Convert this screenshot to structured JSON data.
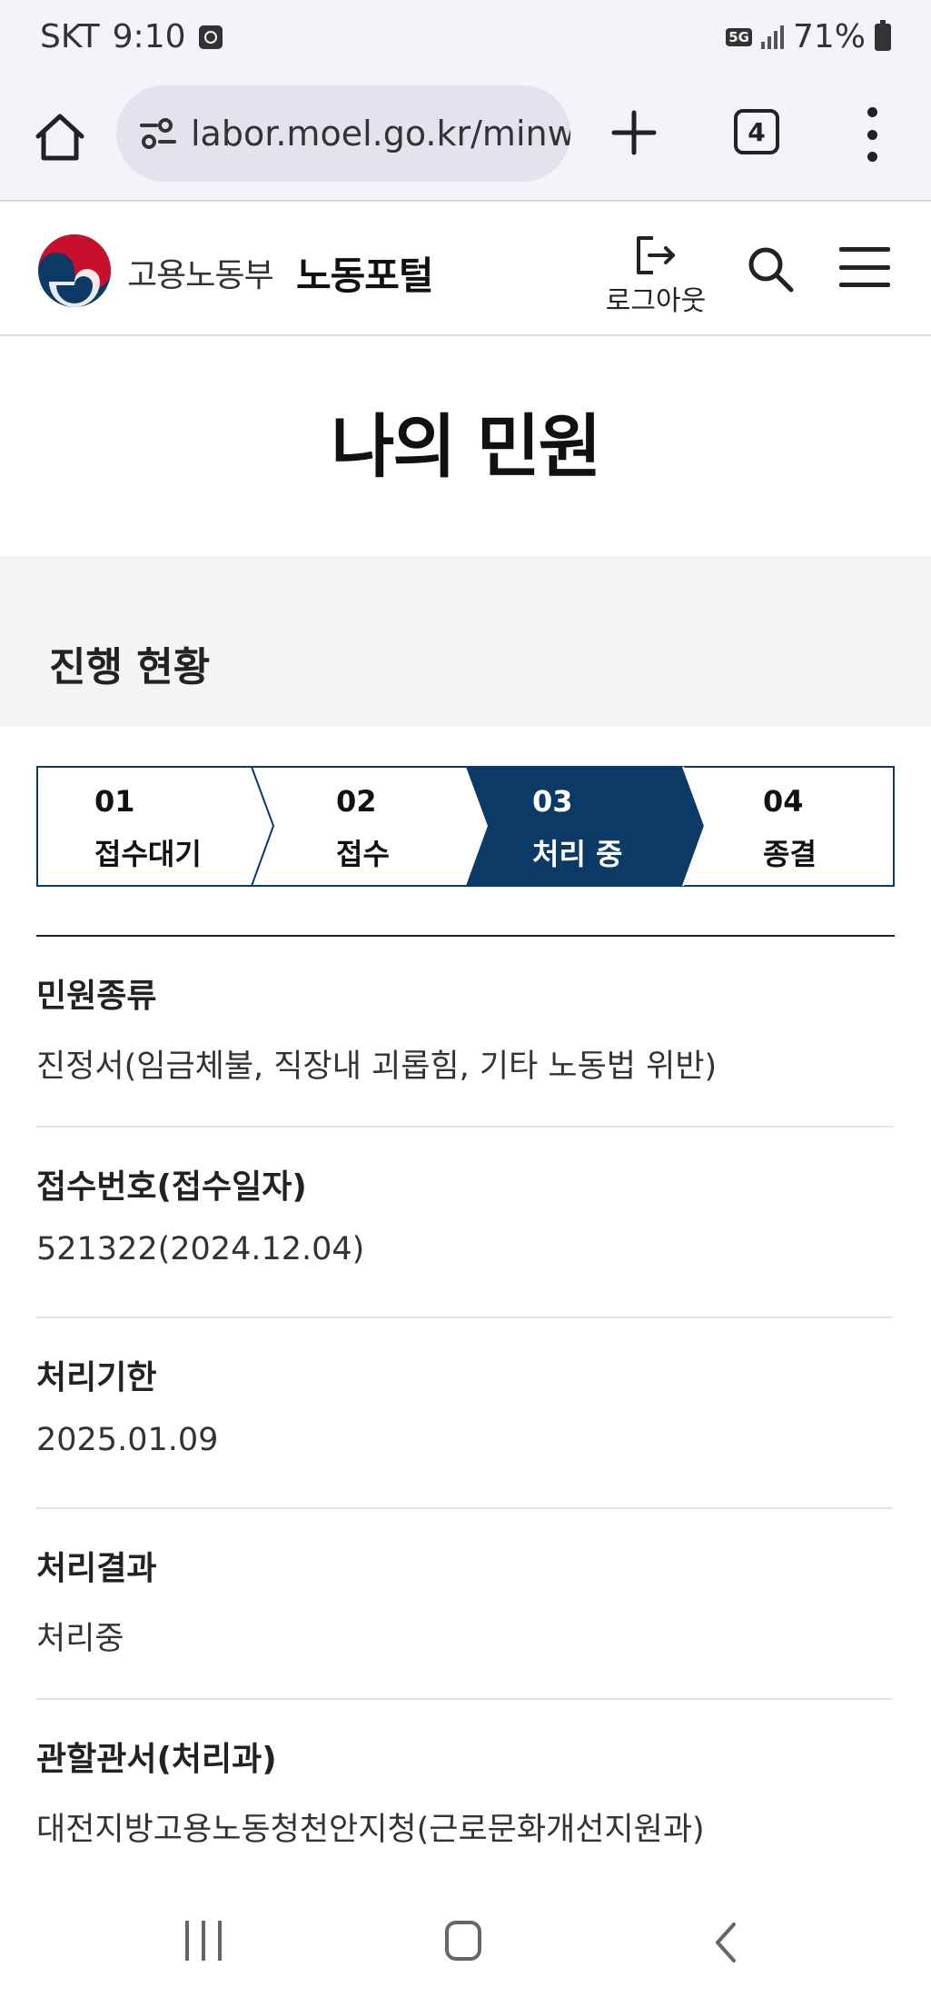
{
  "status_bar": {
    "carrier": "SKT",
    "time": "9:10",
    "network": "5G",
    "battery": "71%"
  },
  "browser": {
    "url": "labor.moel.go.kr/minw",
    "tab_count": "4"
  },
  "site_header": {
    "ministry_name": "고용노동부",
    "portal_name": "노동포털",
    "logout_label": "로그아웃"
  },
  "page": {
    "title": "나의 민원",
    "progress_title": "진행 현황"
  },
  "steps": [
    {
      "num": "01",
      "label": "접수대기",
      "active": false
    },
    {
      "num": "02",
      "label": "접수",
      "active": false
    },
    {
      "num": "03",
      "label": "처리 중",
      "active": true
    },
    {
      "num": "04",
      "label": "종결",
      "active": false
    }
  ],
  "info": [
    {
      "label": "민원종류",
      "value": "진정서(임금체불, 직장내 괴롭힘, 기타 노동법 위반)"
    },
    {
      "label": "접수번호(접수일자)",
      "value": "521322(2024.12.04)"
    },
    {
      "label": "처리기한",
      "value": "2025.01.09"
    },
    {
      "label": "처리결과",
      "value": "처리중"
    },
    {
      "label": "관할관서(처리과)",
      "value": "대전지방고용노동청천안지청(근로문화개선지원과)"
    }
  ],
  "colors": {
    "active_step": "#0b3a66",
    "step_border": "#0b3a66",
    "section_bg": "#f4f4f4"
  }
}
